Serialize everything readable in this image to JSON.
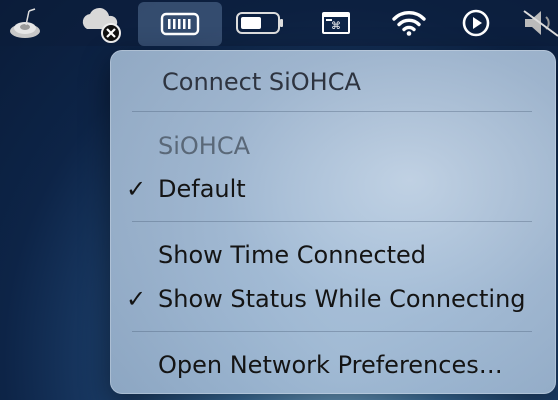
{
  "menubar": {
    "items": [
      {
        "icon": "speaker-snooze-icon"
      },
      {
        "icon": "cloud-disconnected-icon"
      },
      {
        "icon": "modem-icon",
        "active": true
      },
      {
        "icon": "battery-icon"
      },
      {
        "icon": "keyboard-viewer-icon"
      },
      {
        "icon": "wifi-icon"
      },
      {
        "icon": "play-circle-icon"
      },
      {
        "icon": "speaker-muted-icon"
      }
    ]
  },
  "menu": {
    "connect_label": "Connect SiOHCA",
    "service_header": "SiOHCA",
    "default_label": "Default",
    "default_checked": true,
    "show_time_label": "Show Time Connected",
    "show_status_label": "Show Status While Connecting",
    "show_status_checked": true,
    "open_prefs_label": "Open Network Preferences…",
    "checkmark": "✓"
  }
}
